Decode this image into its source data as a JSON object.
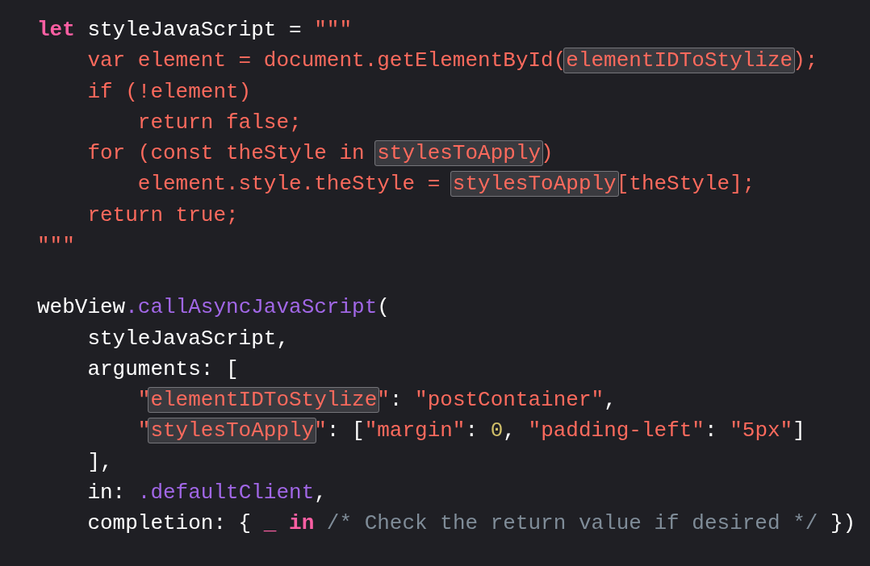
{
  "code_blocks": [
    {
      "lines": [
        {
          "tokens": [
            {
              "text": "let",
              "kind": "keyword",
              "highlighted": false
            },
            {
              "text": " styleJavaScript = ",
              "kind": "plain",
              "highlighted": false
            },
            {
              "text": "\"\"\"",
              "kind": "string",
              "highlighted": false
            }
          ],
          "children": [
            {
              "tokens": [
                {
                  "text": "var element = document.getElementById(",
                  "kind": "string",
                  "highlighted": false
                },
                {
                  "text": "elementIDToStylize",
                  "kind": "string",
                  "highlighted": true
                },
                {
                  "text": ");",
                  "kind": "string",
                  "highlighted": false
                }
              ]
            },
            {
              "tokens": [
                {
                  "text": "if (!element)",
                  "kind": "string",
                  "highlighted": false
                }
              ],
              "children": [
                {
                  "tokens": [
                    {
                      "text": "return false;",
                      "kind": "string",
                      "highlighted": false
                    }
                  ]
                }
              ]
            },
            {
              "tokens": [
                {
                  "text": "for (const theStyle in ",
                  "kind": "string",
                  "highlighted": false
                },
                {
                  "text": "stylesToApply",
                  "kind": "string",
                  "highlighted": true
                },
                {
                  "text": ")",
                  "kind": "string",
                  "highlighted": false
                }
              ],
              "children": [
                {
                  "tokens": [
                    {
                      "text": "element.style.theStyle = ",
                      "kind": "string",
                      "highlighted": false
                    },
                    {
                      "text": "stylesToApply",
                      "kind": "string",
                      "highlighted": true
                    },
                    {
                      "text": "[theStyle];",
                      "kind": "string",
                      "highlighted": false
                    }
                  ]
                }
              ]
            },
            {
              "tokens": [
                {
                  "text": "return true;",
                  "kind": "string",
                  "highlighted": false
                }
              ]
            }
          ]
        },
        {
          "tokens": [
            {
              "text": "\"\"\"",
              "kind": "string",
              "highlighted": false
            }
          ]
        }
      ]
    },
    {
      "lines": [
        {
          "tokens": [
            {
              "text": "webView",
              "kind": "plain",
              "highlighted": false
            },
            {
              "text": ".callAsyncJavaScript",
              "kind": "method",
              "highlighted": false
            },
            {
              "text": "(",
              "kind": "plain",
              "highlighted": false
            }
          ],
          "children": [
            {
              "tokens": [
                {
                  "text": "styleJavaScript,",
                  "kind": "plain",
                  "highlighted": false
                }
              ]
            },
            {
              "tokens": [
                {
                  "text": "arguments: [",
                  "kind": "plain",
                  "highlighted": false
                }
              ],
              "children": [
                {
                  "tokens": [
                    {
                      "text": "\"",
                      "kind": "string",
                      "highlighted": false
                    },
                    {
                      "text": "elementIDToStylize",
                      "kind": "string",
                      "highlighted": true
                    },
                    {
                      "text": "\"",
                      "kind": "string",
                      "highlighted": false
                    },
                    {
                      "text": ": ",
                      "kind": "plain",
                      "highlighted": false
                    },
                    {
                      "text": "\"postContainer\"",
                      "kind": "string",
                      "highlighted": false
                    },
                    {
                      "text": ",",
                      "kind": "plain",
                      "highlighted": false
                    }
                  ]
                },
                {
                  "tokens": [
                    {
                      "text": "\"",
                      "kind": "string",
                      "highlighted": false
                    },
                    {
                      "text": "stylesToApply",
                      "kind": "string",
                      "highlighted": true
                    },
                    {
                      "text": "\"",
                      "kind": "string",
                      "highlighted": false
                    },
                    {
                      "text": ": [",
                      "kind": "plain",
                      "highlighted": false
                    },
                    {
                      "text": "\"margin\"",
                      "kind": "string",
                      "highlighted": false
                    },
                    {
                      "text": ": ",
                      "kind": "plain",
                      "highlighted": false
                    },
                    {
                      "text": "0",
                      "kind": "number",
                      "highlighted": false
                    },
                    {
                      "text": ", ",
                      "kind": "plain",
                      "highlighted": false
                    },
                    {
                      "text": "\"padding-left\"",
                      "kind": "string",
                      "highlighted": false
                    },
                    {
                      "text": ": ",
                      "kind": "plain",
                      "highlighted": false
                    },
                    {
                      "text": "\"5px\"",
                      "kind": "string",
                      "highlighted": false
                    },
                    {
                      "text": "]",
                      "kind": "plain",
                      "highlighted": false
                    }
                  ]
                }
              ]
            },
            {
              "tokens": [
                {
                  "text": "],",
                  "kind": "plain",
                  "highlighted": false
                }
              ]
            },
            {
              "tokens": [
                {
                  "text": "in: ",
                  "kind": "plain",
                  "highlighted": false
                },
                {
                  "text": ".defaultClient",
                  "kind": "method",
                  "highlighted": false
                },
                {
                  "text": ",",
                  "kind": "plain",
                  "highlighted": false
                }
              ]
            },
            {
              "tokens": [
                {
                  "text": "completion: { ",
                  "kind": "plain",
                  "highlighted": false
                },
                {
                  "text": "_",
                  "kind": "keyword",
                  "highlighted": false
                },
                {
                  "text": " in",
                  "kind": "keyword",
                  "highlighted": false
                },
                {
                  "text": " /* Check the return value if desired */",
                  "kind": "comment",
                  "highlighted": false
                },
                {
                  "text": " })",
                  "kind": "plain",
                  "highlighted": false
                }
              ]
            }
          ]
        }
      ]
    }
  ]
}
